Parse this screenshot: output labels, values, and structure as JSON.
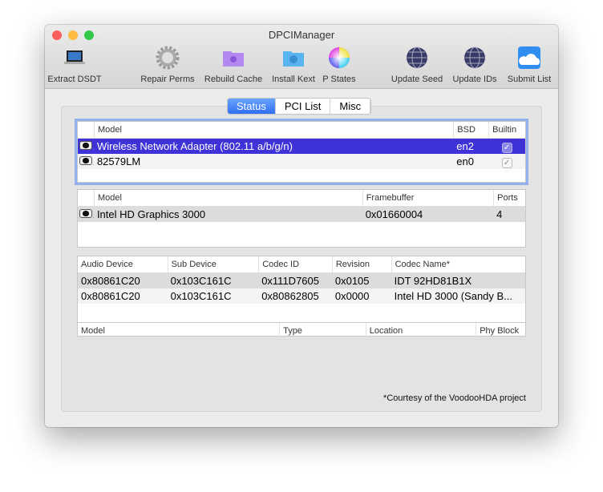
{
  "window": {
    "title": "DPCIManager"
  },
  "toolbar": [
    {
      "label": "Extract DSDT",
      "icon": "laptop-icon"
    },
    {
      "label": "Repair Perms",
      "icon": "gear-icon"
    },
    {
      "label": "Rebuild Cache",
      "icon": "folder-gear-icon"
    },
    {
      "label": "Install Kext",
      "icon": "folder-kext-icon"
    },
    {
      "label": "P States",
      "icon": "color-wheel-icon"
    },
    {
      "label": "Update Seed",
      "icon": "globe-icon"
    },
    {
      "label": "Update IDs",
      "icon": "globe-icon"
    },
    {
      "label": "Submit List",
      "icon": "cloud-icon"
    }
  ],
  "tabs": [
    {
      "label": "Status",
      "active": true
    },
    {
      "label": "PCI List"
    },
    {
      "label": "Misc"
    }
  ],
  "network": {
    "headers": [
      "",
      "Model",
      "BSD",
      "Builtin"
    ],
    "rows": [
      [
        "",
        "Wireless Network Adapter (802.11 a/b/g/n)",
        "en2",
        "✓"
      ],
      [
        "",
        "82579LM",
        "en0",
        "✓"
      ]
    ]
  },
  "graphics": {
    "headers": [
      "",
      "Model",
      "Framebuffer",
      "Ports"
    ],
    "rows": [
      [
        "",
        "Intel HD Graphics 3000",
        "0x01660004",
        "4"
      ]
    ]
  },
  "audio": {
    "headers": [
      "Audio Device",
      "Sub Device",
      "Codec ID",
      "Revision",
      "Codec Name*"
    ],
    "rows": [
      [
        "0x80861C20",
        "0x103C161C",
        "0x111D7605",
        "0x0105",
        "IDT 92HD81B1X"
      ],
      [
        "0x80861C20",
        "0x103C161C",
        "0x80862805",
        "0x0000",
        "Intel HD 3000 (Sandy B..."
      ]
    ]
  },
  "storage": {
    "headers": [
      "Model",
      "Type",
      "Location",
      "Phy Block"
    ],
    "rows": []
  },
  "footnote": "*Courtesy of the VoodooHDA project"
}
